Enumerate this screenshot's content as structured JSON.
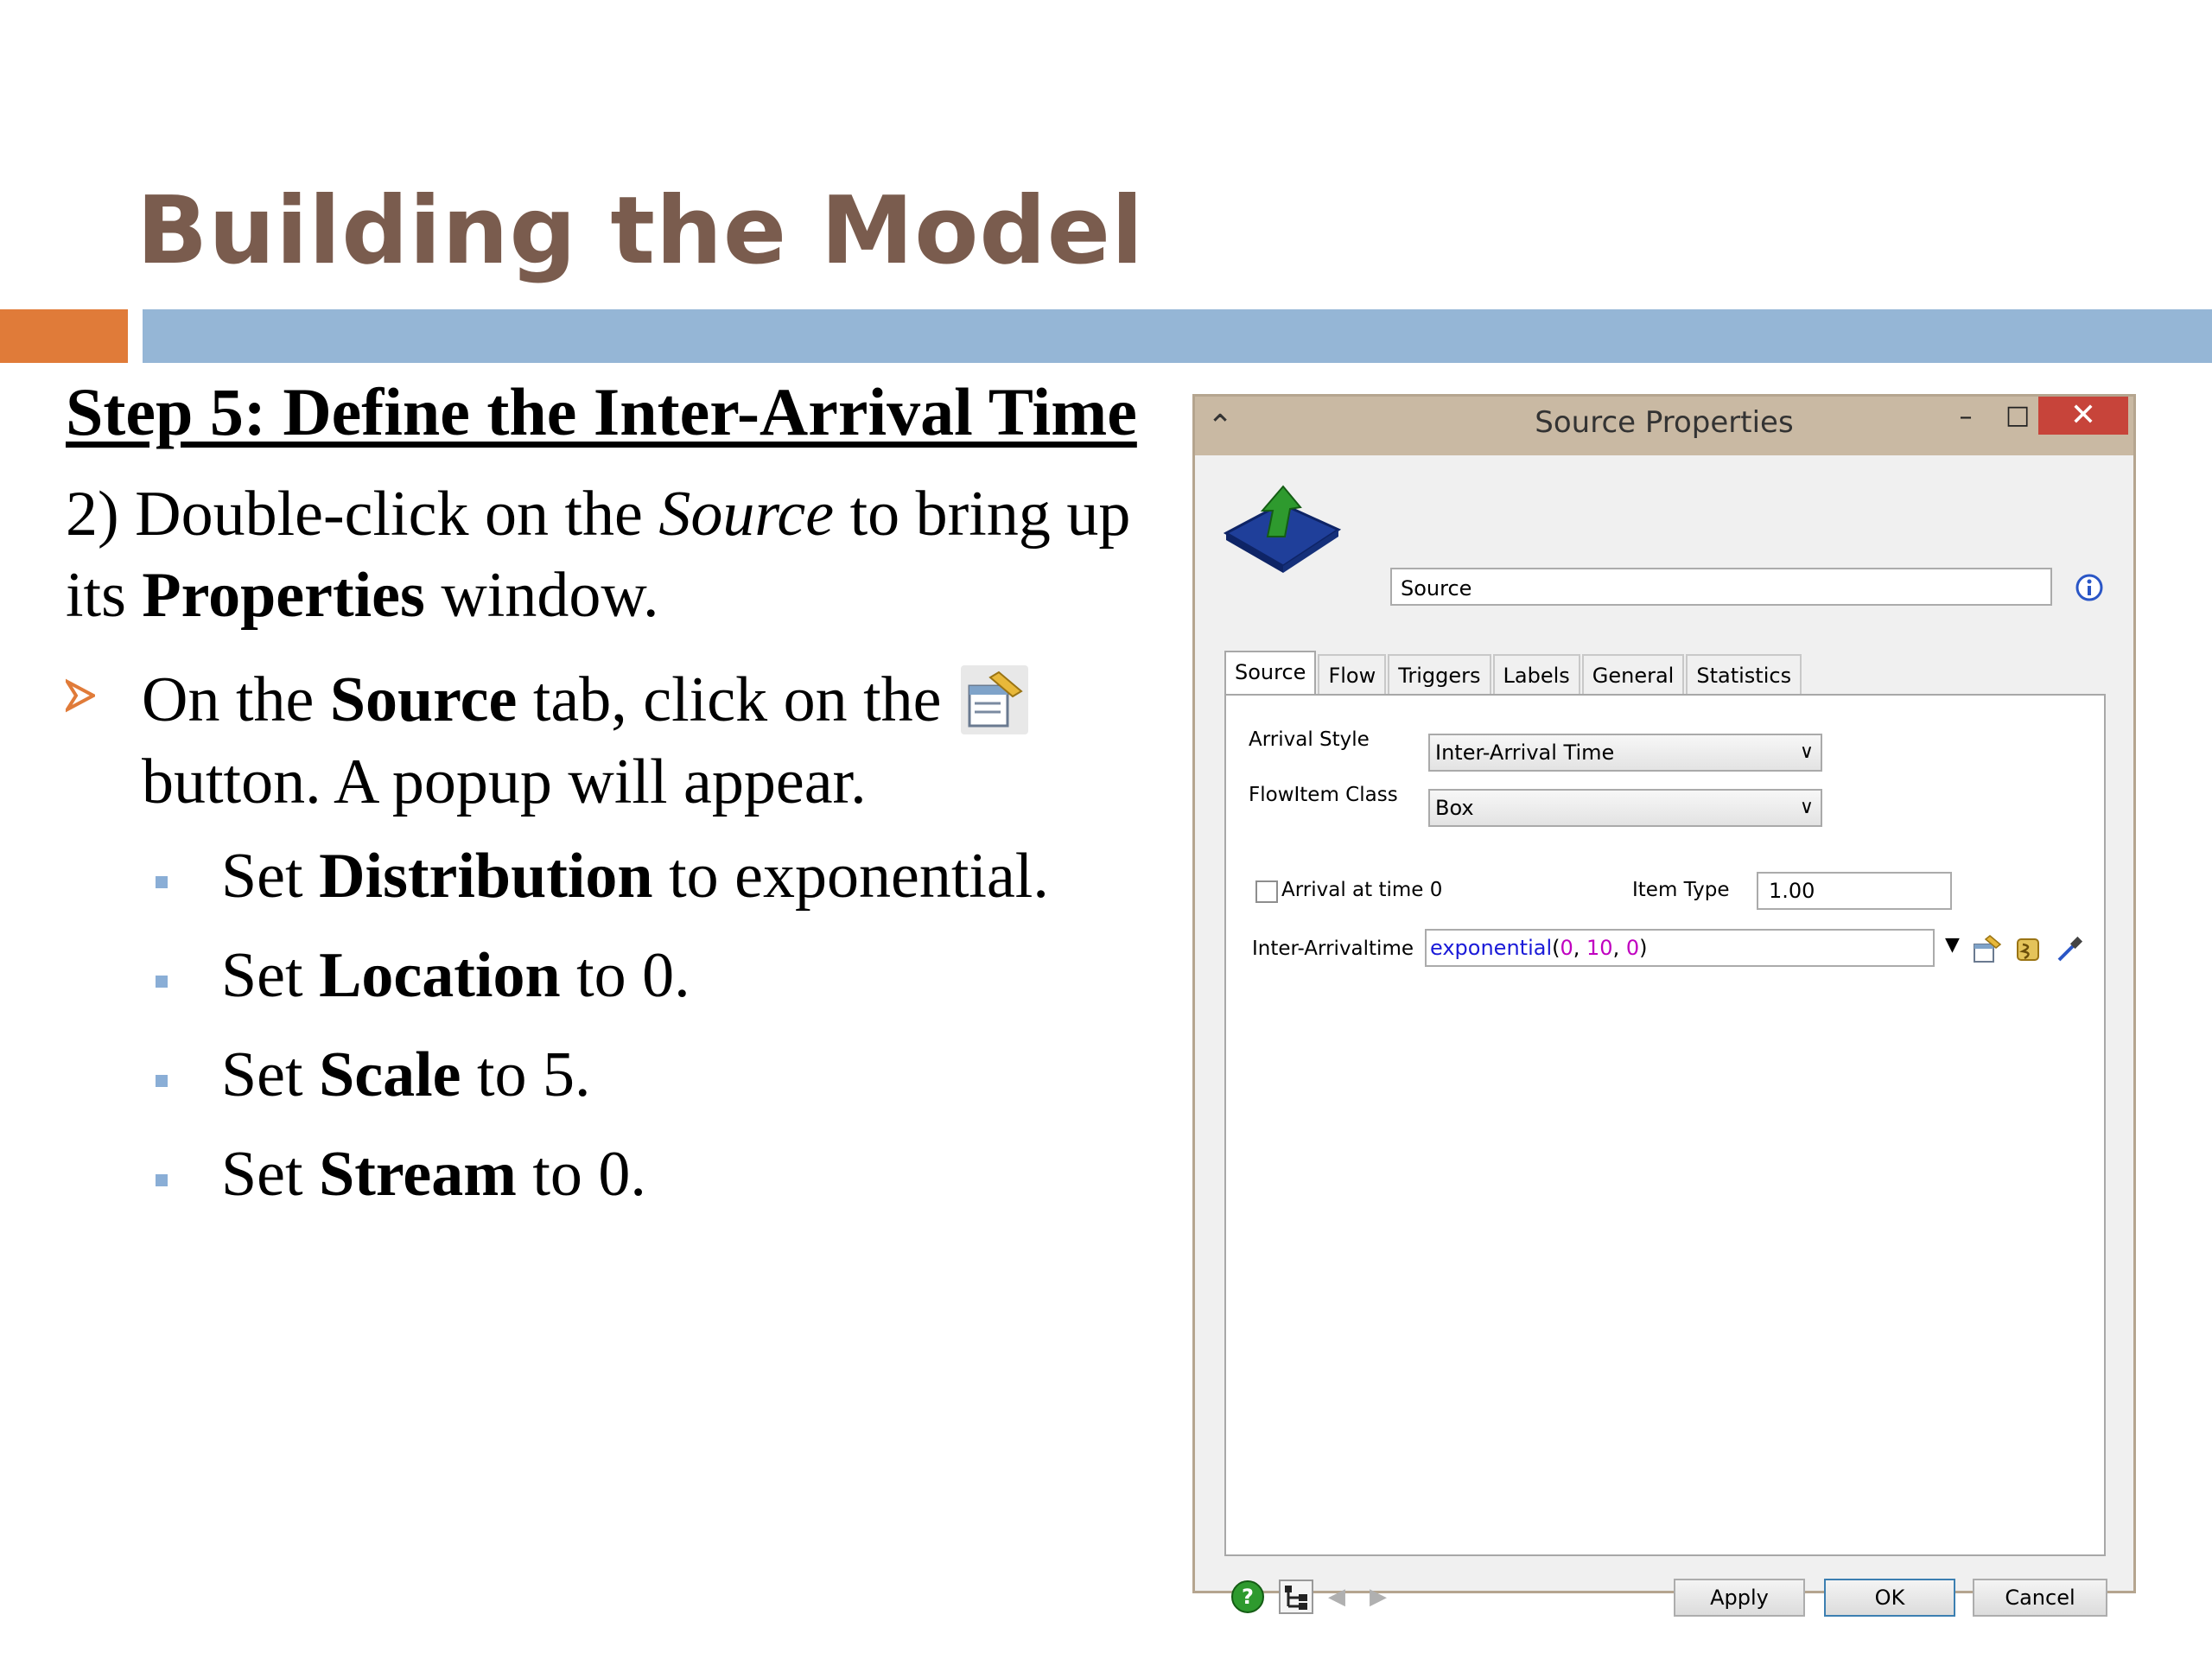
{
  "slide": {
    "title": "Building the Model",
    "step_heading": "Step 5: Define the Inter-Arrival Time",
    "intro": {
      "prefix": "2) Double-click on the ",
      "source_italic": "Source",
      "middle": " to bring up its ",
      "properties_bold": "Properties",
      "suffix": " window."
    },
    "bullet": {
      "part1": "On the ",
      "source_bold": "Source",
      "part2": " tab, click on the ",
      "part3": " button. A popup will appear."
    },
    "subbullets": [
      {
        "prefix": "Set ",
        "bold": "Distribution",
        "suffix": " to exponential."
      },
      {
        "prefix": "Set ",
        "bold": "Location",
        "suffix": " to 0."
      },
      {
        "prefix": "Set ",
        "bold": "Scale",
        "suffix": " to 5."
      },
      {
        "prefix": "Set ",
        "bold": "Stream",
        "suffix": " to 0."
      }
    ]
  },
  "dialog": {
    "title": "Source  Properties",
    "name_value": "Source",
    "tabs": [
      "Source",
      "Flow",
      "Triggers",
      "Labels",
      "General",
      "Statistics"
    ],
    "arrival_style_label": "Arrival Style",
    "arrival_style_value": "Inter-Arrival Time",
    "flowitem_class_label": "FlowItem Class",
    "flowitem_class_value": "Box",
    "arrival_at_time0_label": "Arrival at time 0",
    "item_type_label": "Item Type",
    "item_type_value": "1.00",
    "inter_arrival_label": "Inter-Arrivaltime",
    "inter_arrival_code": {
      "fn": "exponential",
      "open": "(",
      "a": "0",
      "sep1": ", ",
      "b": "10",
      "sep2": ", ",
      "c": "0",
      "close": ")"
    },
    "buttons": {
      "apply": "Apply",
      "ok": "OK",
      "cancel": "Cancel"
    }
  }
}
